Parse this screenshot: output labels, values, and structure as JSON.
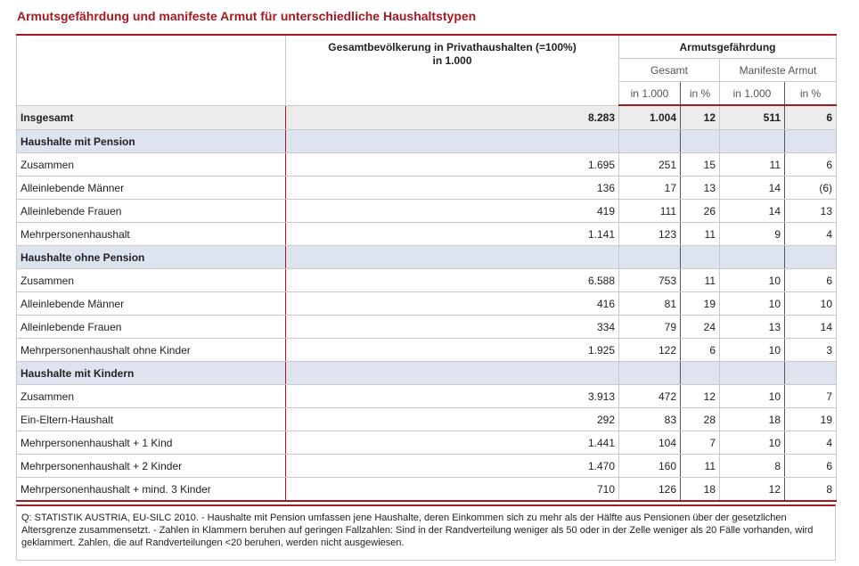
{
  "title": "Armutsgefährdung und manifeste Armut für unterschiedliche Haushaltstypen",
  "header": {
    "population_line1": "Gesamtbevölkerung in Privathaushalten (=100%)",
    "population_line2": "in 1.000",
    "group": "Armutsgefährdung",
    "sub_total": "Gesamt",
    "sub_manifest": "Manifeste Armut",
    "unit_abs": "in 1.000",
    "unit_pct": "in %"
  },
  "total": {
    "label": "Insgesamt",
    "pop": "8.283",
    "ag_abs": "1.004",
    "ag_pct": "12",
    "ma_abs": "511",
    "ma_pct": "6"
  },
  "sections": [
    {
      "heading": "Haushalte mit Pension",
      "rows": [
        {
          "label": "Zusammen",
          "pop": "1.695",
          "ag_abs": "251",
          "ag_pct": "15",
          "ma_abs": "11",
          "ma_pct": "6"
        },
        {
          "label": "Alleinlebende Männer",
          "pop": "136",
          "ag_abs": "17",
          "ag_pct": "13",
          "ma_abs": "14",
          "ma_pct": "(6)"
        },
        {
          "label": "Alleinlebende Frauen",
          "pop": "419",
          "ag_abs": "111",
          "ag_pct": "26",
          "ma_abs": "14",
          "ma_pct": "13"
        },
        {
          "label": "Mehrpersonenhaushalt",
          "pop": "1.141",
          "ag_abs": "123",
          "ag_pct": "11",
          "ma_abs": "9",
          "ma_pct": "4"
        }
      ]
    },
    {
      "heading": "Haushalte ohne Pension",
      "rows": [
        {
          "label": "Zusammen",
          "pop": "6.588",
          "ag_abs": "753",
          "ag_pct": "11",
          "ma_abs": "10",
          "ma_pct": "6"
        },
        {
          "label": "Alleinlebende Männer",
          "pop": "416",
          "ag_abs": "81",
          "ag_pct": "19",
          "ma_abs": "10",
          "ma_pct": "10"
        },
        {
          "label": "Alleinlebende Frauen",
          "pop": "334",
          "ag_abs": "79",
          "ag_pct": "24",
          "ma_abs": "13",
          "ma_pct": "14"
        },
        {
          "label": "Mehrpersonenhaushalt ohne Kinder",
          "pop": "1.925",
          "ag_abs": "122",
          "ag_pct": "6",
          "ma_abs": "10",
          "ma_pct": "3"
        }
      ]
    },
    {
      "heading": "Haushalte mit Kindern",
      "rows": [
        {
          "label": "Zusammen",
          "pop": "3.913",
          "ag_abs": "472",
          "ag_pct": "12",
          "ma_abs": "10",
          "ma_pct": "7"
        },
        {
          "label": "Ein-Eltern-Haushalt",
          "pop": "292",
          "ag_abs": "83",
          "ag_pct": "28",
          "ma_abs": "18",
          "ma_pct": "19"
        },
        {
          "label": "Mehrpersonenhaushalt + 1 Kind",
          "pop": "1.441",
          "ag_abs": "104",
          "ag_pct": "7",
          "ma_abs": "10",
          "ma_pct": "4"
        },
        {
          "label": "Mehrpersonenhaushalt + 2 Kinder",
          "pop": "1.470",
          "ag_abs": "160",
          "ag_pct": "11",
          "ma_abs": "8",
          "ma_pct": "6"
        },
        {
          "label": "Mehrpersonenhaushalt + mind. 3 Kinder",
          "pop": "710",
          "ag_abs": "126",
          "ag_pct": "18",
          "ma_abs": "12",
          "ma_pct": "8"
        }
      ]
    }
  ],
  "footnote": "Q: STATISTIK AUSTRIA, EU-SILC 2010. - Haushalte mit Pension umfassen jene Haushalte, deren Einkommen sich zu mehr als der Hälfte aus Pensionen über der gesetzlichen Altersgrenze zusammensetzt. - Zahlen in Klammern beruhen auf geringen Fallzahlen: Sind in der Randverteilung weniger als 50 oder in der Zelle weniger als 20 Fälle vorhanden, wird geklammert. Zahlen, die auf Randverteilungen <20 beruhen, werden nicht ausgewiesen."
}
